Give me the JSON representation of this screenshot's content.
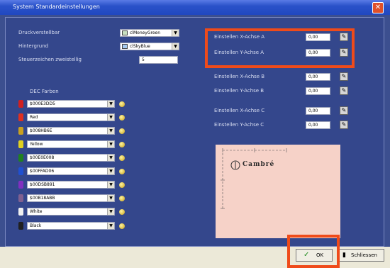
{
  "window": {
    "title": "System Standardeinstellungen",
    "close_glyph": "✕"
  },
  "left": {
    "druckverstellbar": {
      "label": "Druckverstellbar",
      "value": "clMoneyGreen",
      "swatch": "#c8e0c0"
    },
    "hintergrund": {
      "label": "Hintergrund",
      "value": "clSkyBlue",
      "swatch": "#a6caf0"
    },
    "steuerzeichen": {
      "label": "Steuerzeichen zweistellig",
      "value": "5"
    },
    "dec_label": "DEC Farben",
    "colors": [
      {
        "chip": "#d02020",
        "value": "$000E3DD5"
      },
      {
        "chip": "#e03020",
        "value": "Red"
      },
      {
        "chip": "#c8a020",
        "value": "$008HB6E"
      },
      {
        "chip": "#e0d020",
        "value": "Yellow"
      },
      {
        "chip": "#208020",
        "value": "$00E0E008"
      },
      {
        "chip": "#2050d0",
        "value": "$00FFAD06"
      },
      {
        "chip": "#8030c0",
        "value": "$00DSB891"
      },
      {
        "chip": "#806090",
        "value": "$00B18ABB"
      },
      {
        "chip": "#f0f0f0",
        "value": "White"
      },
      {
        "chip": "#202020",
        "value": "Black"
      }
    ]
  },
  "right": {
    "axes": [
      {
        "label": "Einstellen X-Achse A",
        "value": "0,00"
      },
      {
        "label": "Einstellen Y-Achse A",
        "value": "0,00"
      },
      {
        "label": "Einstellen X-Achse B",
        "value": "0,00"
      },
      {
        "label": "Einstellen Y-Achse B",
        "value": "0,00"
      },
      {
        "label": "Einstellen X-Achse C",
        "value": "0,00"
      },
      {
        "label": "Einstellen Y-Achse C",
        "value": "0,00"
      }
    ],
    "preview": {
      "sample_text": "Cambré"
    }
  },
  "buttons": {
    "ok_label": "OK",
    "close_label": "Schliessen"
  },
  "colors": {
    "highlight": "#ef4b1a",
    "panel": "#34478c"
  }
}
